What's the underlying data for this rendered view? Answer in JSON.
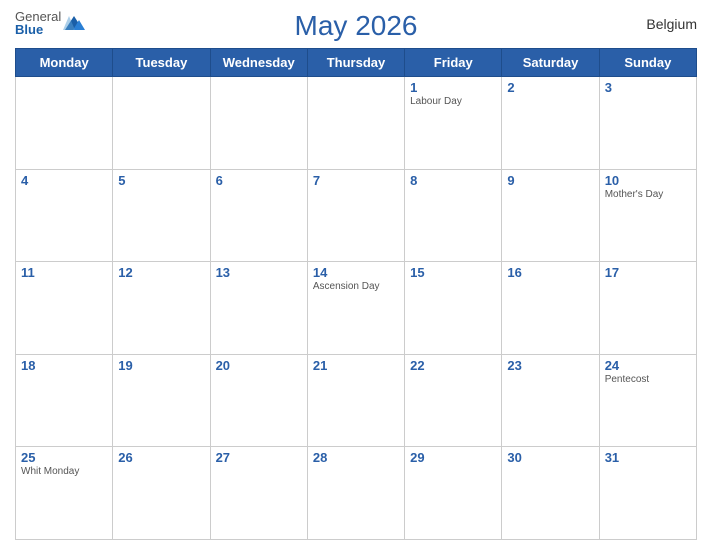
{
  "header": {
    "logo_general": "General",
    "logo_blue": "Blue",
    "title": "May 2026",
    "country": "Belgium"
  },
  "weekdays": [
    "Monday",
    "Tuesday",
    "Wednesday",
    "Thursday",
    "Friday",
    "Saturday",
    "Sunday"
  ],
  "weeks": [
    [
      {
        "day": "",
        "holiday": ""
      },
      {
        "day": "",
        "holiday": ""
      },
      {
        "day": "",
        "holiday": ""
      },
      {
        "day": "",
        "holiday": ""
      },
      {
        "day": "1",
        "holiday": "Labour Day"
      },
      {
        "day": "2",
        "holiday": ""
      },
      {
        "day": "3",
        "holiday": ""
      }
    ],
    [
      {
        "day": "4",
        "holiday": ""
      },
      {
        "day": "5",
        "holiday": ""
      },
      {
        "day": "6",
        "holiday": ""
      },
      {
        "day": "7",
        "holiday": ""
      },
      {
        "day": "8",
        "holiday": ""
      },
      {
        "day": "9",
        "holiday": ""
      },
      {
        "day": "10",
        "holiday": "Mother's Day"
      }
    ],
    [
      {
        "day": "11",
        "holiday": ""
      },
      {
        "day": "12",
        "holiday": ""
      },
      {
        "day": "13",
        "holiday": ""
      },
      {
        "day": "14",
        "holiday": "Ascension Day"
      },
      {
        "day": "15",
        "holiday": ""
      },
      {
        "day": "16",
        "holiday": ""
      },
      {
        "day": "17",
        "holiday": ""
      }
    ],
    [
      {
        "day": "18",
        "holiday": ""
      },
      {
        "day": "19",
        "holiday": ""
      },
      {
        "day": "20",
        "holiday": ""
      },
      {
        "day": "21",
        "holiday": ""
      },
      {
        "day": "22",
        "holiday": ""
      },
      {
        "day": "23",
        "holiday": ""
      },
      {
        "day": "24",
        "holiday": "Pentecost"
      }
    ],
    [
      {
        "day": "25",
        "holiday": "Whit Monday"
      },
      {
        "day": "26",
        "holiday": ""
      },
      {
        "day": "27",
        "holiday": ""
      },
      {
        "day": "28",
        "holiday": ""
      },
      {
        "day": "29",
        "holiday": ""
      },
      {
        "day": "30",
        "holiday": ""
      },
      {
        "day": "31",
        "holiday": ""
      }
    ]
  ]
}
